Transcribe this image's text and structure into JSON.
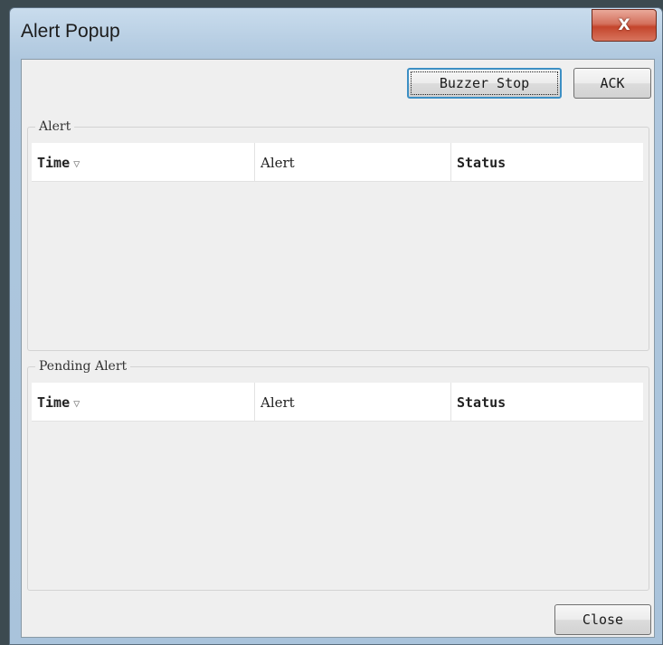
{
  "window": {
    "title": "Alert Popup",
    "close_glyph": "X"
  },
  "toolbar": {
    "buzzer_stop_label": "Buzzer Stop",
    "ack_label": "ACK"
  },
  "alert_group": {
    "title": "Alert",
    "columns": [
      "Time",
      "Alert",
      "Status"
    ],
    "sort_indicator": "▽"
  },
  "pending_group": {
    "title": "Pending Alert",
    "columns": [
      "Time",
      "Alert",
      "Status"
    ],
    "sort_indicator": "▽"
  },
  "footer": {
    "close_label": "Close"
  }
}
